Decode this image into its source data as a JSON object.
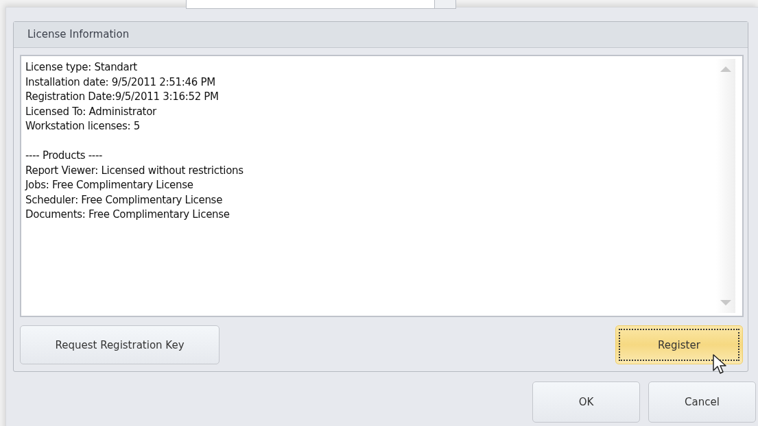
{
  "group": {
    "title": "License Information"
  },
  "info_text": {
    "paragraphs": [
      [
        "License type: Standart",
        "Installation date: 9/5/2011 2:51:46 PM",
        "Registration Date:9/5/2011 3:16:52 PM",
        "Licensed To: Administrator",
        "Workstation licenses: 5"
      ],
      [
        "---- Products ----",
        "Report Viewer: Licensed without restrictions",
        "Jobs: Free Complimentary License",
        "Scheduler: Free Complimentary License",
        "Documents: Free Complimentary License"
      ]
    ]
  },
  "group_buttons": [
    {
      "label": "Request Registration Key",
      "focused": false
    },
    {
      "label": "Register",
      "focused": true
    }
  ],
  "dialog_buttons": [
    {
      "label": "OK",
      "focused": false
    },
    {
      "label": "Cancel",
      "focused": false
    }
  ]
}
